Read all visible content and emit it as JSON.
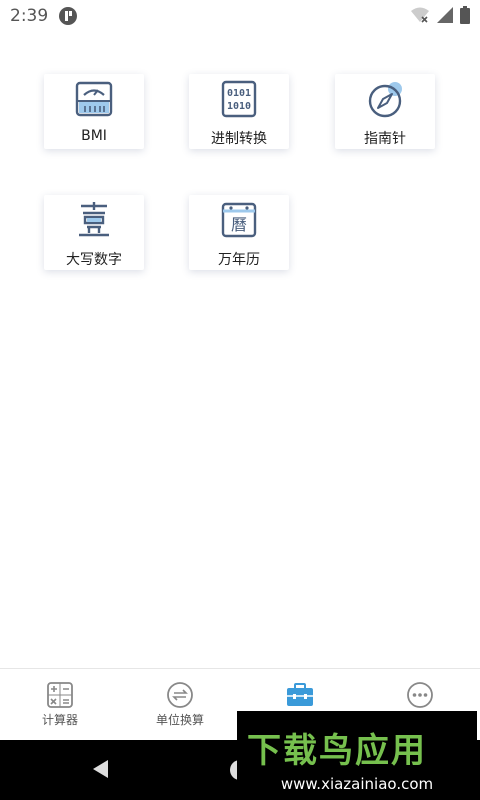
{
  "status": {
    "time": "2:39"
  },
  "tools": [
    {
      "label": "BMI",
      "icon": "scale-icon"
    },
    {
      "label": "进制转换",
      "icon": "binary-icon"
    },
    {
      "label": "指南针",
      "icon": "compass-icon"
    },
    {
      "label": "大写数字",
      "icon": "chinese-numeral-icon"
    },
    {
      "label": "万年历",
      "icon": "calendar-icon"
    }
  ],
  "nav": [
    {
      "label": "计算器",
      "icon": "calculator-icon"
    },
    {
      "label": "单位换算",
      "icon": "unit-convert-icon"
    },
    {
      "label": "",
      "icon": "toolbox-icon",
      "active": true
    },
    {
      "label": "",
      "icon": "more-icon"
    }
  ],
  "watermark": {
    "title": "下载鸟应用",
    "url": "www.xiazainiao.com"
  },
  "colors": {
    "icon": "#4a5f7e",
    "accent": "#3a9ad9",
    "active_nav": "#3a9ad9"
  }
}
